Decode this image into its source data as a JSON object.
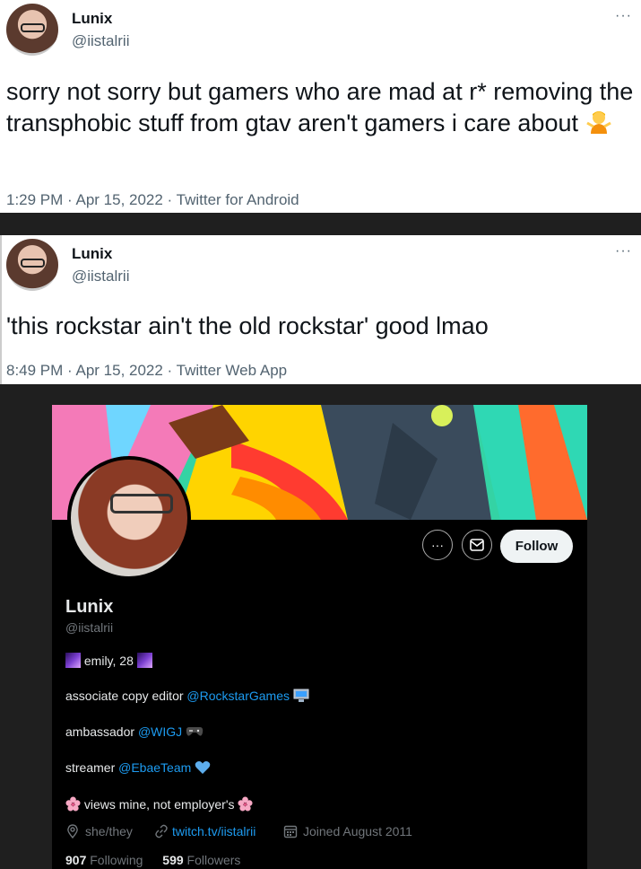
{
  "tweet1": {
    "name": "Lunix",
    "handle": "@iistalrii",
    "more": "···",
    "text": "sorry not sorry but gamers who are mad at r* removing the transphobic stuff from gtav aren't gamers i care about",
    "emoji": "person-gesturing-no-emoji",
    "time": "1:29 PM · Apr 15, 2022 · Twitter for Android"
  },
  "tweet2": {
    "name": "Lunix",
    "handle": "@iistalrii",
    "more": "···",
    "text": "'this rockstar ain't the old rockstar' good lmao",
    "time": "8:49 PM · Apr 15, 2022 · Twitter Web App"
  },
  "profile": {
    "more_icon": "···",
    "follow_label": "Follow",
    "name": "Lunix",
    "handle": "@iistalrii",
    "bio_line1": "emily, 28",
    "bio_line2_text": "associate copy editor ",
    "bio_line2_link": "@RockstarGames",
    "bio_line3_text": "ambassador ",
    "bio_line3_link": "@WIGJ",
    "bio_line4_text": "streamer ",
    "bio_line4_link": "@EbaeTeam",
    "bio_line5": "views mine, not employer's",
    "pronouns": "she/they",
    "website": "twitch.tv/iistalrii",
    "joined": "Joined August 2011",
    "following_count": "907",
    "following_label": "Following",
    "followers_count": "599",
    "followers_label": "Followers"
  }
}
